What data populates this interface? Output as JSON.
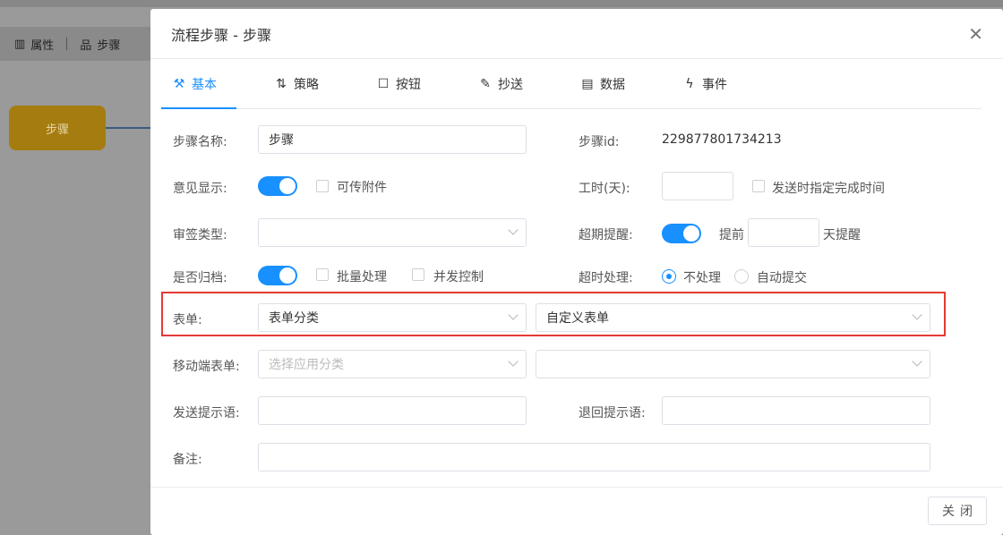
{
  "background": {
    "toolbar": {
      "attr_label": "属性",
      "step_label": "步骤"
    },
    "step_node_label": "步骤"
  },
  "modal": {
    "title": "流程步骤 - 步骤",
    "tabs": [
      {
        "label": "基本",
        "icon": "wrench-icon",
        "active": true
      },
      {
        "label": "策略",
        "icon": "branch-icon",
        "active": false
      },
      {
        "label": "按钮",
        "icon": "square-icon",
        "active": false
      },
      {
        "label": "抄送",
        "icon": "edit-icon",
        "active": false
      },
      {
        "label": "数据",
        "icon": "table-icon",
        "active": false
      },
      {
        "label": "事件",
        "icon": "lightning-icon",
        "active": false
      }
    ],
    "form": {
      "step_name_label": "步骤名称:",
      "step_name_value": "步骤",
      "step_id_label": "步骤id:",
      "step_id_value": "229877801734213",
      "opinion_label": "意见显示:",
      "attach_label": "可传附件",
      "worktime_label": "工时(天):",
      "worktime_value": "",
      "specify_time_label": "发送时指定完成时间",
      "sign_type_label": "审签类型:",
      "sign_type_value": "",
      "overdue_label": "超期提醒:",
      "advance_label": "提前",
      "advance_value": "",
      "days_remind_label": "天提醒",
      "archive_label": "是否归档:",
      "batch_label": "批量处理",
      "concurrent_label": "并发控制",
      "timeout_label": "超时处理:",
      "no_handle_label": "不处理",
      "auto_submit_label": "自动提交",
      "form_label": "表单:",
      "form_category_value": "表单分类",
      "custom_form_value": "自定义表单",
      "mobile_form_label": "移动端表单:",
      "mobile_category_placeholder": "选择应用分类",
      "mobile_form_value": "",
      "send_tip_label": "发送提示语:",
      "send_tip_value": "",
      "return_tip_label": "退回提示语:",
      "return_tip_value": "",
      "remark_label": "备注:",
      "remark_value": ""
    },
    "close_button_label": "关闭"
  },
  "colors": {
    "accent": "#1890ff",
    "highlight": "#e53935",
    "step_node": "#a57c10"
  }
}
